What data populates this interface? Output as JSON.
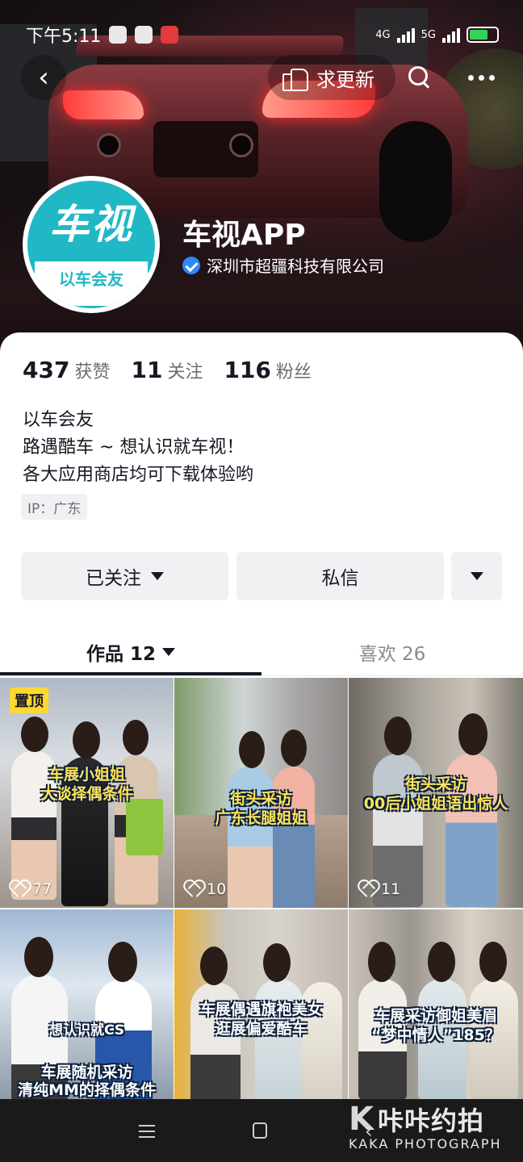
{
  "status_bar": {
    "time": "下午5:11",
    "network": "4G",
    "network2": "5G",
    "battery_level": 0.7
  },
  "top_nav": {
    "back_icon": "chevron-left-icon",
    "update_label": "求更新",
    "update_icon": "thumb-point-icon",
    "search_icon": "search-icon",
    "more_icon": "more-dots-icon"
  },
  "profile": {
    "avatar_text": "车视",
    "avatar_subtext": "以车会友",
    "name": "车视APP",
    "verified_org": "深圳市超疆科技有限公司"
  },
  "stats": [
    {
      "num": "437",
      "label": "获赞"
    },
    {
      "num": "11",
      "label": "关注"
    },
    {
      "num": "116",
      "label": "粉丝"
    }
  ],
  "bio": {
    "line1": "以车会友",
    "line2": "路遇酷车 ~ 想认识就车视！",
    "line3": "各大应用商店均可下载体验哟"
  },
  "ip_tag": "IP：广东",
  "actions": {
    "followed_label": "已关注",
    "message_label": "私信"
  },
  "tabs": {
    "works_label": "作品 12",
    "likes_label": "喜欢 26"
  },
  "videos": [
    {
      "pinned": "置顶",
      "caption1": "车展小姐姐",
      "caption2": "大谈择偶条件",
      "likes": "77"
    },
    {
      "caption1": "街头采访",
      "caption2": "广东长腿姐姐",
      "likes": "10"
    },
    {
      "caption1": "街头采访",
      "caption2": "00后小姐姐语出惊人",
      "likes": "11"
    },
    {
      "caption0": "想认识就CS",
      "caption1": "车展随机采访",
      "caption2": "清纯MM的择偶条件"
    },
    {
      "caption1": "车展偶遇旗袍美女",
      "caption2": "逛展偏爱酷车"
    },
    {
      "caption1": "车展采访御姐美眉",
      "caption2": "“梦中情人”185？"
    }
  ],
  "watermark": {
    "main": "咔咔约拍",
    "sub": "KAKA PHOTOGRAPH"
  },
  "colors": {
    "avatar_teal": "#21b8c5",
    "verify_blue": "#2f86ff",
    "pin_yellow": "#fdd832"
  }
}
